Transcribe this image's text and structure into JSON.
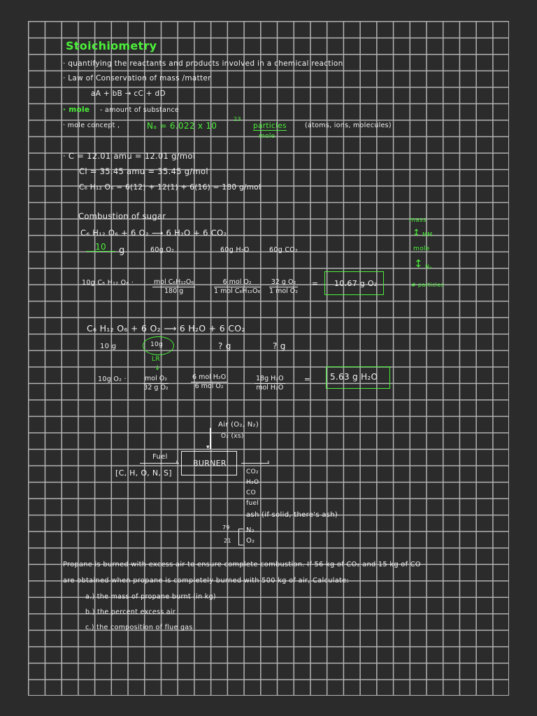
{
  "title": "Stoichiometry",
  "intro": {
    "definition": "· quantifying the reactants and products involved in a chemical reaction",
    "law": "· Law of Conservation of mass /matter",
    "general_equation": "aA + bB  →  cC + dD",
    "mole_label": "· mole",
    "mole_def": "- amount of substance",
    "mole_concept": "· mole concept ,",
    "avogadro": "Nₐ = 6.022 x 10",
    "avogadro_exp": "23",
    "particles": "particles",
    "per_mole": "mole",
    "particle_types": "(atoms, ions, molecules)"
  },
  "molar_masses": [
    "· C = 12.01 amu = 12.01 g/mol",
    "Cl = 35.45 amu = 35.45 g/mol",
    "C₆ H₁₂ O₆ = 6(12) + 12(1) + 6(16) = 180 g/mol"
  ],
  "combustion": {
    "heading": "Combustion of sugar",
    "equation": "C₆ H₁₂ O₆   + 6 O₂   ⟶   6 H₂O   + 6 CO₂",
    "given_value": "10",
    "given_unit": "g",
    "o2_mass": "60g O₂",
    "h2o_mass": "60g H₂O",
    "co2_mass": "60g CO₂",
    "calc1_start": "10g  C₆ H₁₂ O₆ ·",
    "calc1_f1": [
      "mol C₆H₁₂O₆",
      "180 g"
    ],
    "calc1_f2": [
      "6 mol O₂",
      "1 mol C₆H₁₂O₆"
    ],
    "calc1_f3": [
      "32 g O₂",
      "1 mol O₂"
    ],
    "equals": "=",
    "result1": "10.67 g O₂",
    "equation2": "C₆ H₁₂ O₆  + 6 O₂  ⟶   6 H₂O   + 6 CO₂",
    "given2": "10 g",
    "o2_given": "10g",
    "unknown_h2o": "? g",
    "unknown_co2": "? g",
    "limiting": "LR",
    "down_arrow": "↓",
    "calc2_start": "10g O₂  ·",
    "calc2_f1": [
      "mol O₂",
      "32 g O₂"
    ],
    "calc2_f2": [
      "6 mol H₂O",
      "6 mol O₂"
    ],
    "calc2_f3": [
      "18g  H₂O",
      "mol H₂O"
    ],
    "result2": "5.63  g H₂O"
  },
  "conversion_chart": {
    "mass": "mass",
    "mm": "MM",
    "mole": "mole",
    "na": "Nₐ",
    "particles": "# particles",
    "arrow": "↕"
  },
  "burner": {
    "air": "Air (O₂, N₂)",
    "o2_excess": "O₂ (xs)",
    "fuel": "Fuel",
    "fuel_elements": "[C, H, O, N, S]",
    "label": "BURNER",
    "products": [
      "CO₂",
      "H₂O",
      "CO",
      "fuel",
      "ash (if solid, there's ash)"
    ],
    "air_comp": [
      {
        "pct": "79",
        "gas": "N₂"
      },
      {
        "pct": "21",
        "gas": "O₂"
      }
    ]
  },
  "problem": {
    "line1": "Propane is burned with excess air to ensure complete combustion. If 56 kg of CO₂ and 15 kg of CO",
    "line2": "are obtained when propane is completely burned with 500 kg of air, Calculate:",
    "a": "a.) the mass of propane burnt (in kg)",
    "b": "b.) the percent excess air",
    "c": "c.) the composition of flue gas"
  }
}
